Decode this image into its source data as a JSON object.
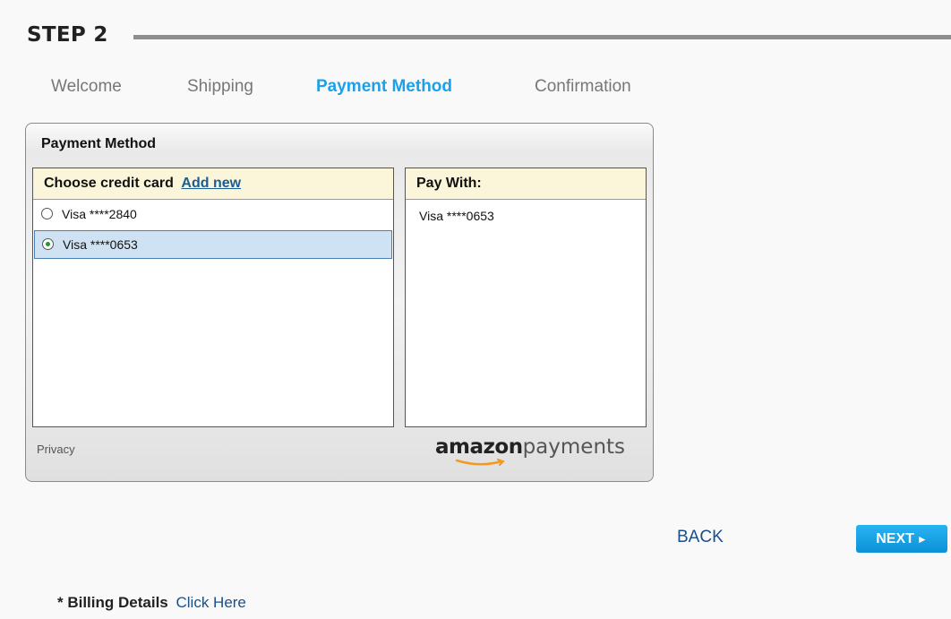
{
  "step": {
    "title": "STEP 2"
  },
  "tabs": [
    {
      "label": "Welcome",
      "active": false
    },
    {
      "label": "Shipping",
      "active": false
    },
    {
      "label": "Payment Method",
      "active": true
    },
    {
      "label": "Confirmation",
      "active": false
    }
  ],
  "widget": {
    "title": "Payment Method",
    "choose_header": "Choose credit card",
    "add_new_link": "Add new",
    "cards": [
      {
        "label": "Visa ****2840",
        "selected": false
      },
      {
        "label": "Visa ****0653",
        "selected": true
      }
    ],
    "pay_with_header": "Pay With:",
    "pay_with_value": "Visa ****0653",
    "privacy_link": "Privacy",
    "logo": {
      "bold": "amazon",
      "light": "payments"
    }
  },
  "nav": {
    "back_label": "BACK",
    "next_label": "NEXT",
    "next_arrow": "►"
  },
  "billing": {
    "label": "* Billing Details",
    "link": "Click Here"
  },
  "colors": {
    "active_tab": "#1e9fe6",
    "next_button": "#1ba4e6",
    "selected_row": "#cfe2f3",
    "panel_header": "#fbf6d9",
    "radio_dot": "#1d9a2a",
    "logo_smile": "#f39a1e"
  }
}
